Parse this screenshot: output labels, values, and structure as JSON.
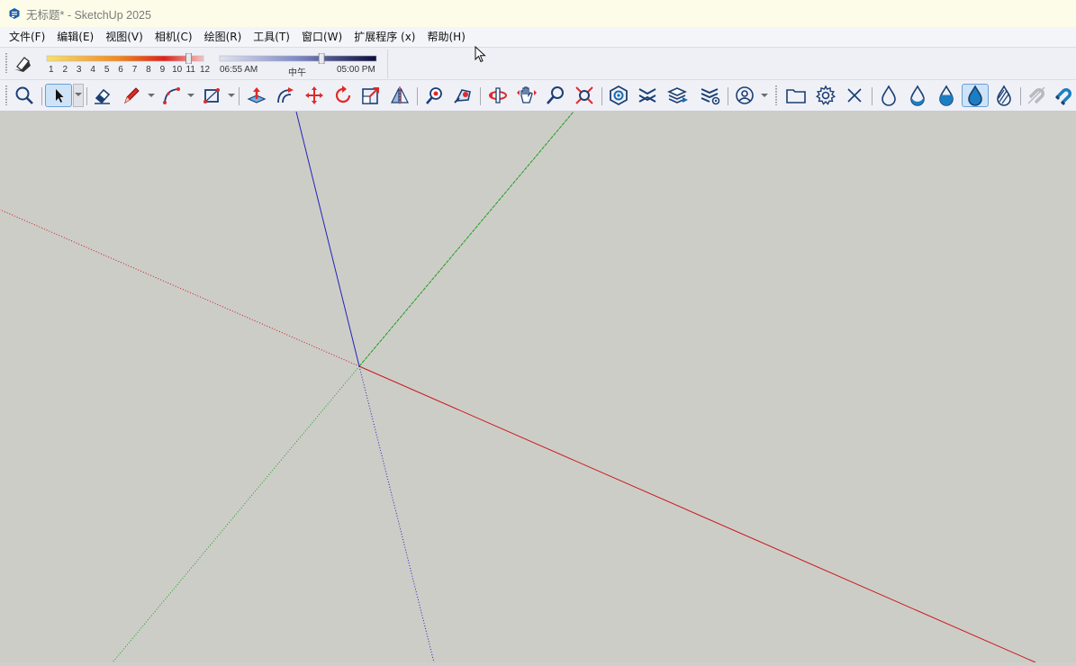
{
  "window": {
    "title": "无标题* - SketchUp 2025"
  },
  "menu": [
    {
      "label": "文件(F)"
    },
    {
      "label": "编辑(E)"
    },
    {
      "label": "视图(V)"
    },
    {
      "label": "相机(C)"
    },
    {
      "label": "绘图(R)"
    },
    {
      "label": "工具(T)"
    },
    {
      "label": "窗口(W)"
    },
    {
      "label": "扩展程序 (x)"
    },
    {
      "label": "帮助(H)"
    }
  ],
  "shadows": {
    "month_ticks": [
      "1",
      "2",
      "3",
      "4",
      "5",
      "6",
      "7",
      "8",
      "9",
      "10",
      "11",
      "12"
    ],
    "month_value": 11,
    "time_start": "06:55 AM",
    "time_mid": "中午",
    "time_end": "05:00 PM",
    "time_fraction": 0.65
  },
  "toolbar": [
    {
      "name": "zoom-extents-icon"
    },
    {
      "name": "select-icon",
      "active": true
    },
    {
      "name": "eraser-icon"
    },
    {
      "name": "pencil-icon"
    },
    {
      "name": "arc-icon"
    },
    {
      "name": "rectangle-icon"
    },
    {
      "name": "push-pull-icon"
    },
    {
      "name": "offset-icon"
    },
    {
      "name": "move-icon"
    },
    {
      "name": "rotate-icon"
    },
    {
      "name": "scale-icon"
    },
    {
      "name": "flip-icon"
    },
    {
      "name": "paint-bucket-icon"
    },
    {
      "name": "tag-icon"
    },
    {
      "name": "orbit-icon"
    },
    {
      "name": "pan-icon"
    },
    {
      "name": "zoom-icon"
    },
    {
      "name": "zoom-window-icon"
    },
    {
      "name": "component-options-icon"
    },
    {
      "name": "section-plane-icon"
    },
    {
      "name": "layers-export-icon"
    },
    {
      "name": "layers-settings-icon"
    },
    {
      "name": "account-icon"
    },
    {
      "name": "folder-icon"
    },
    {
      "name": "gear-icon"
    },
    {
      "name": "close-icon"
    },
    {
      "name": "drop-empty-icon"
    },
    {
      "name": "drop-half-icon"
    },
    {
      "name": "drop-third-icon"
    },
    {
      "name": "drop-full-icon"
    },
    {
      "name": "drop-striped-icon"
    },
    {
      "name": "magnet-off-icon"
    },
    {
      "name": "magnet-icon"
    }
  ],
  "axes": {
    "red": "#c8191c",
    "green": "#1e9e1e",
    "blue": "#2222b8"
  }
}
